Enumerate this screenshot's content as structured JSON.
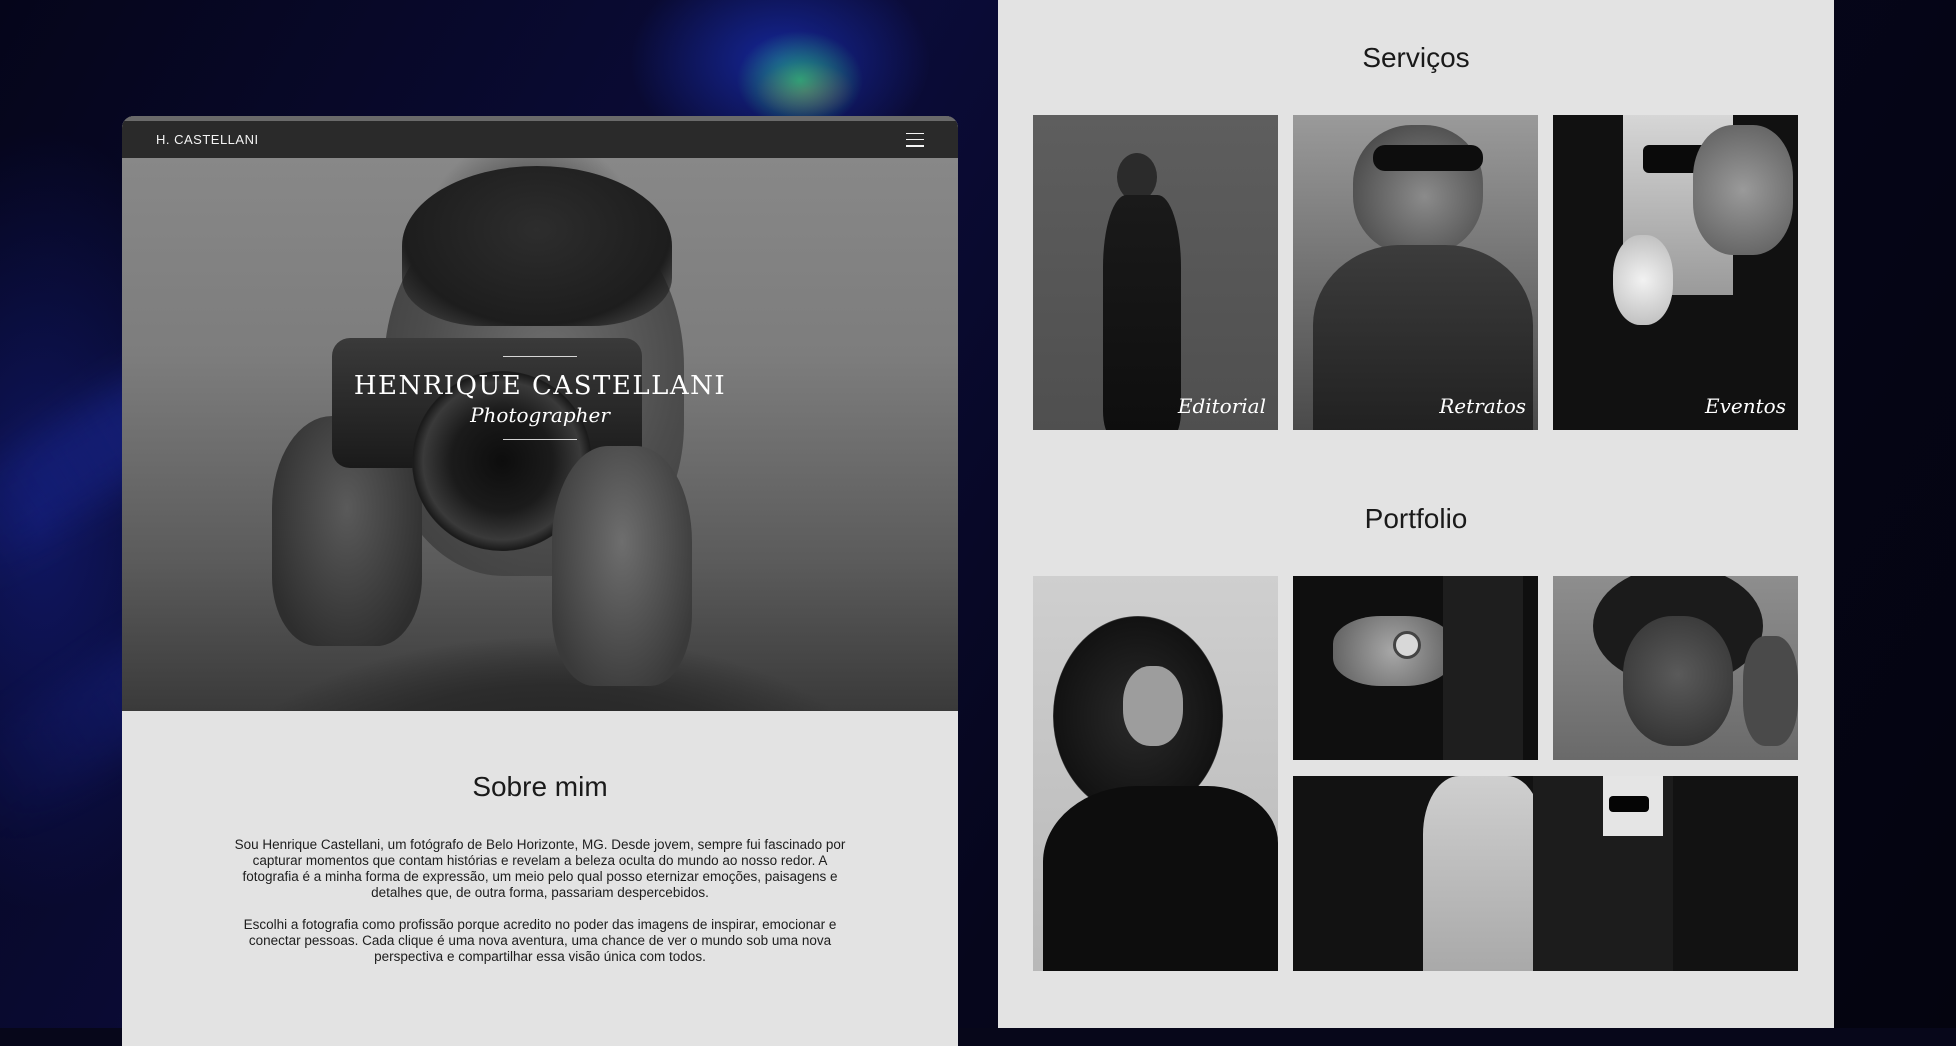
{
  "site": {
    "brand": "H. CASTELLANI",
    "menu_icon": "hamburger-menu-icon"
  },
  "hero": {
    "name": "HENRIQUE CASTELLANI",
    "role": "Photographer"
  },
  "about": {
    "title": "Sobre mim",
    "paragraphs": [
      "Sou Henrique Castellani, um fotógrafo de Belo Horizonte, MG. Desde jovem, sempre fui fascinado por capturar momentos que contam histórias e revelam a beleza oculta do mundo ao nosso redor. A fotografia é a minha forma de expressão, um meio pelo qual posso eternizar emoções, paisagens e detalhes que, de outra forma, passariam despercebidos.",
      "Escolhi a fotografia como profissão porque acredito no poder das imagens de inspirar, emocionar e conectar pessoas. Cada clique é uma nova aventura, uma chance de ver o mundo sob uma nova perspectiva e compartilhar essa visão única com todos."
    ]
  },
  "services": {
    "title": "Serviços",
    "items": [
      {
        "label": "Editorial"
      },
      {
        "label": "Retratos"
      },
      {
        "label": "Eventos"
      }
    ]
  },
  "portfolio": {
    "title": "Portfolio"
  }
}
